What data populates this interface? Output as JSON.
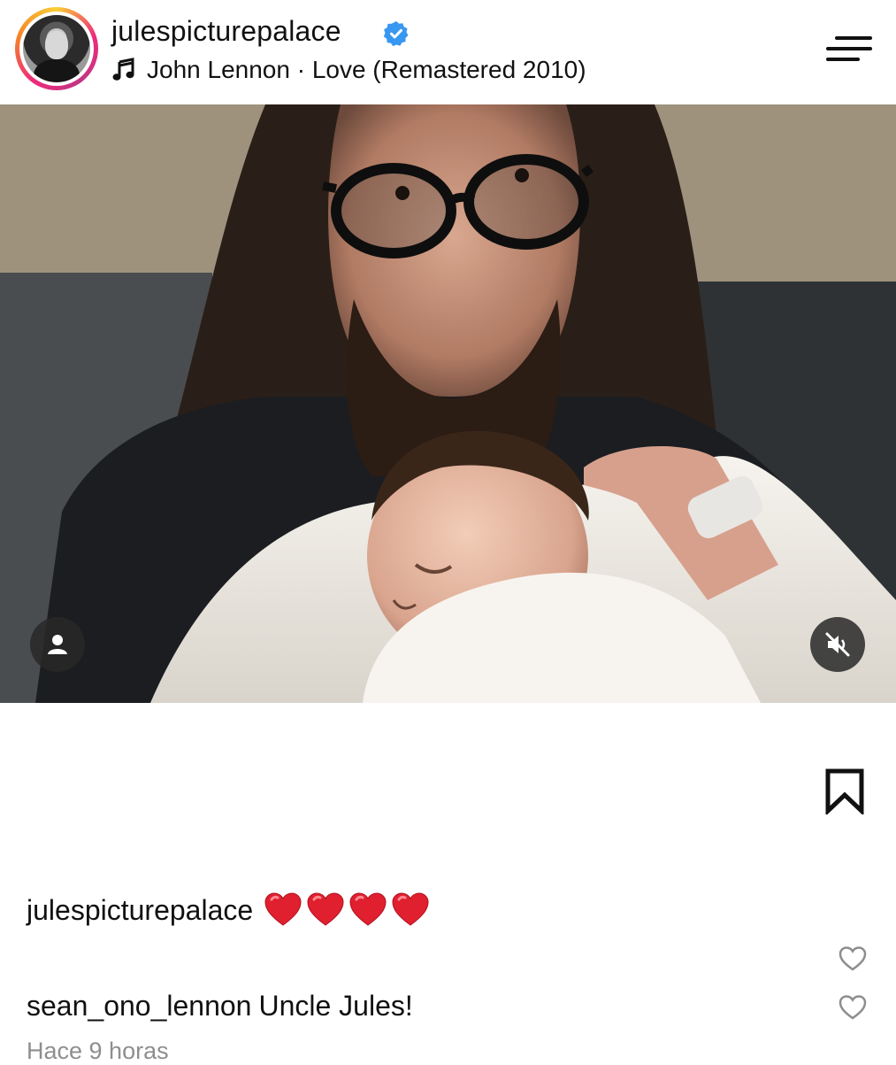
{
  "header": {
    "username": "julespicturepalace",
    "verified": true,
    "music": "John Lennon · Love (Remastered 2010)"
  },
  "post": {
    "image_description_icon_user": "user-tag-icon",
    "mute_icon": "speaker-muted-icon"
  },
  "caption": {
    "username": "julespicturepalace",
    "emoji_count": 4,
    "heart_color": "#e0202f"
  },
  "comments": [
    {
      "username": "sean_ono_lennon",
      "text": "Uncle Jules!"
    }
  ],
  "timestamp": "Hace 9 horas",
  "colors": {
    "verified_blue": "#3897f0",
    "secondary_text": "#8e8e8e"
  }
}
